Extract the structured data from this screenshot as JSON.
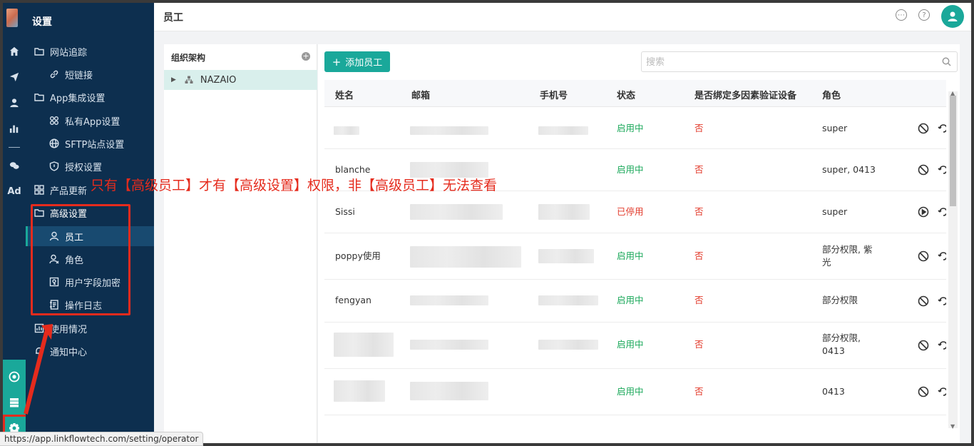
{
  "sidebar": {
    "title": "设置",
    "items": [
      {
        "label": "网站追踪"
      },
      {
        "label": "短链接"
      },
      {
        "label": "App集成设置"
      },
      {
        "label": "私有App设置"
      },
      {
        "label": "SFTP站点设置"
      },
      {
        "label": "授权设置"
      },
      {
        "label": "产品更新"
      },
      {
        "label": "高级设置"
      },
      {
        "label": "员工"
      },
      {
        "label": "角色"
      },
      {
        "label": "用户字段加密"
      },
      {
        "label": "操作日志"
      },
      {
        "label": "使用情况"
      },
      {
        "label": "通知中心"
      }
    ],
    "active": "员工"
  },
  "rail": {
    "ad_label": "Ad"
  },
  "header": {
    "title": "员工"
  },
  "org": {
    "title": "组织架构",
    "root": "NAZAIO"
  },
  "toolbar": {
    "add_label": "添加员工",
    "search_placeholder": "搜索"
  },
  "table": {
    "columns": [
      "姓名",
      "邮箱",
      "手机号",
      "状态",
      "是否绑定多因素验证设备",
      "角色"
    ],
    "rows": [
      {
        "name": "",
        "status": "启用中",
        "mfa": "否",
        "role": "super",
        "action": "disable"
      },
      {
        "name": "blanche",
        "status": "启用中",
        "mfa": "否",
        "role": "super, 0413",
        "action": "disable"
      },
      {
        "name": "Sissi",
        "status": "已停用",
        "mfa": "否",
        "role": "super",
        "action": "enable"
      },
      {
        "name": "poppy使用",
        "status": "启用中",
        "mfa": "否",
        "role": "部分权限, 紫光",
        "action": "disable"
      },
      {
        "name": "fengyan",
        "status": "启用中",
        "mfa": "否",
        "role": "部分权限",
        "action": "disable"
      },
      {
        "name": "",
        "status": "启用中",
        "mfa": "否",
        "role": "部分权限, 0413",
        "action": "disable"
      },
      {
        "name": "",
        "status": "启用中",
        "mfa": "否",
        "role": "0413",
        "action": "disable"
      }
    ]
  },
  "annotation": "只有【高级员工】才有【高级设置】权限，非【高级员工】无法查看",
  "status_url": "https://app.linkflowtech.com/setting/operator",
  "colors": {
    "sidebar": "#0d2f4f",
    "accent": "#1aa89a",
    "active_status": "#1aa85a",
    "alert": "#e52b1d"
  }
}
